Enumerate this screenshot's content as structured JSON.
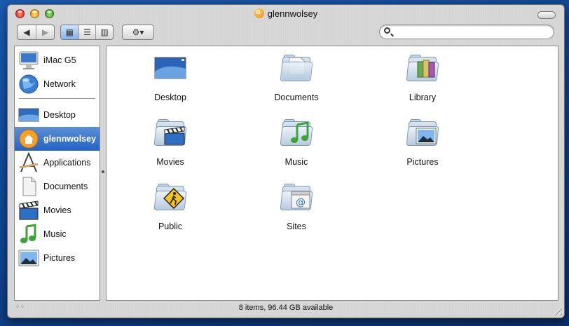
{
  "window": {
    "title": "glennwolsey"
  },
  "toolbar": {
    "back_icon": "◀",
    "forward_icon": "▶",
    "icon_view_icon": "▦",
    "list_view_icon": "☰",
    "column_view_icon": "▥",
    "action_icon": "⚙▾",
    "search_placeholder": "",
    "active_view": "icon"
  },
  "sidebar": {
    "devices": [
      {
        "label": "iMac G5",
        "icon": "imac-icon"
      },
      {
        "label": "Network",
        "icon": "network-globe-icon"
      }
    ],
    "places": [
      {
        "label": "Desktop",
        "icon": "desktop-icon"
      },
      {
        "label": "glennwolsey",
        "icon": "home-icon",
        "selected": true
      },
      {
        "label": "Applications",
        "icon": "applications-icon"
      },
      {
        "label": "Documents",
        "icon": "documents-icon"
      },
      {
        "label": "Movies",
        "icon": "movies-icon"
      },
      {
        "label": "Music",
        "icon": "music-icon"
      },
      {
        "label": "Pictures",
        "icon": "pictures-icon"
      }
    ]
  },
  "content": {
    "items": [
      {
        "label": "Desktop",
        "icon": "desktop-folder-icon"
      },
      {
        "label": "Documents",
        "icon": "documents-folder-icon"
      },
      {
        "label": "Library",
        "icon": "library-folder-icon"
      },
      {
        "label": "Movies",
        "icon": "movies-folder-icon"
      },
      {
        "label": "Music",
        "icon": "music-folder-icon"
      },
      {
        "label": "Pictures",
        "icon": "pictures-folder-icon"
      },
      {
        "label": "Public",
        "icon": "public-folder-icon"
      },
      {
        "label": "Sites",
        "icon": "sites-folder-icon"
      }
    ]
  },
  "status": {
    "text": "8 items, 96.44 GB available"
  },
  "colors": {
    "selection": "#2463c4",
    "desktop_bg": "#1b5bb3"
  }
}
